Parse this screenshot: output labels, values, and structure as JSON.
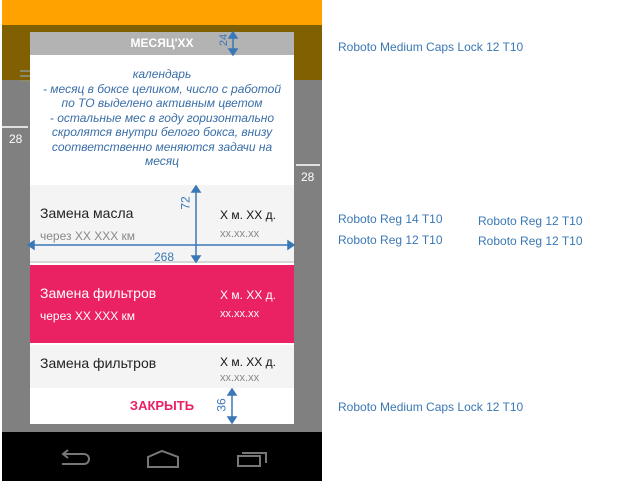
{
  "dialog": {
    "title": "МЕСЯЦ'XX",
    "note": "календарь\n- месяц в боксе целиком, число с работой по ТО выделено активным цветом\n- остальные мес в году горизонтально скролятся внутри белого бокса, внизу соответственно меняются задачи на месяц",
    "items": [
      {
        "title": "Замена масла",
        "subtitle": "через XX XXX км",
        "right_title": "X м. XX д.",
        "right_date": "xx.xx.xx",
        "active": false
      },
      {
        "title": "Замена фильтров",
        "subtitle": "через XX XXX км",
        "right_title": "X м. XX д.",
        "right_date": "xx.xx.xx",
        "active": true
      },
      {
        "title": "Замена фильтров",
        "subtitle": "",
        "right_title": "X м. XX д.",
        "right_date": "xx.xx.xx",
        "active": false
      }
    ],
    "close_label": "ЗАКРЫТЬ"
  },
  "dimensions": {
    "header_h": "24",
    "margin_left": "28",
    "margin_right": "28",
    "item_h": "72",
    "item_w": "268",
    "footer_h": "36"
  },
  "annotations": {
    "header_font": "Roboto Medium Caps Lock 12 T10",
    "title_font": "Roboto Reg 14 T10",
    "subtitle_font": "Roboto Reg 12 T10",
    "right_title_font": "Roboto Reg 12 T10",
    "right_date_font": "Roboto Reg 12 T10",
    "button_font": "Roboto Medium Caps Lock 12 T10"
  },
  "colors": {
    "status": "#ffa200",
    "toolbar": "#806000",
    "accent": "#ea2163",
    "annotation": "#3a78b5"
  }
}
